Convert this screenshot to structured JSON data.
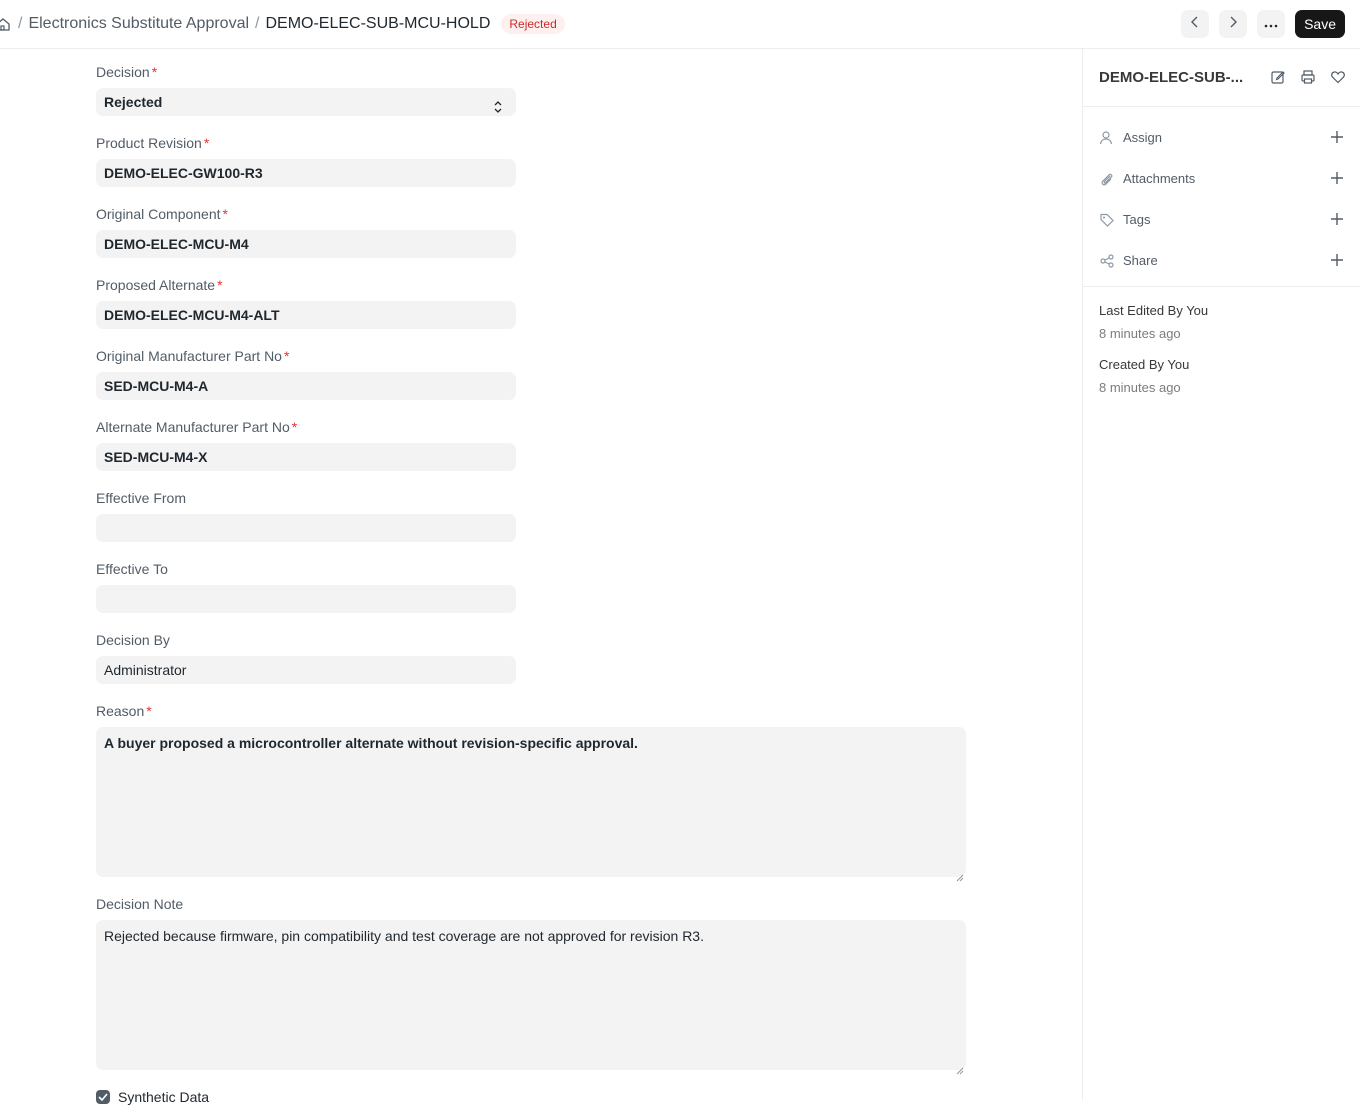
{
  "breadcrumb": {
    "parent": "Electronics Substitute Approval",
    "current": "DEMO-ELEC-SUB-MCU-HOLD",
    "separator": "/"
  },
  "status": {
    "label": "Rejected",
    "color": "#cc2929"
  },
  "toolbar": {
    "save_label": "Save"
  },
  "form": {
    "decision": {
      "label": "Decision",
      "value": "Rejected"
    },
    "product_revision": {
      "label": "Product Revision",
      "value": "DEMO-ELEC-GW100-R3"
    },
    "original_component": {
      "label": "Original Component",
      "value": "DEMO-ELEC-MCU-M4"
    },
    "proposed_alternate": {
      "label": "Proposed Alternate",
      "value": "DEMO-ELEC-MCU-M4-ALT"
    },
    "original_mpn": {
      "label": "Original Manufacturer Part No",
      "value": "SED-MCU-M4-A"
    },
    "alternate_mpn": {
      "label": "Alternate Manufacturer Part No",
      "value": "SED-MCU-M4-X"
    },
    "effective_from": {
      "label": "Effective From",
      "value": ""
    },
    "effective_to": {
      "label": "Effective To",
      "value": ""
    },
    "decision_by": {
      "label": "Decision By",
      "value": "Administrator"
    },
    "reason": {
      "label": "Reason",
      "value": "A buyer proposed a microcontroller alternate without revision-specific approval."
    },
    "decision_note": {
      "label": "Decision Note",
      "value": "Rejected because firmware, pin compatibility and test coverage are not approved for revision R3."
    },
    "synthetic_data": {
      "label": "Synthetic Data",
      "checked": true
    },
    "required_marker": "*"
  },
  "sidebar": {
    "title": "DEMO-ELEC-SUB-...",
    "items": [
      {
        "label": "Assign",
        "icon": "user-icon"
      },
      {
        "label": "Attachments",
        "icon": "paperclip-icon"
      },
      {
        "label": "Tags",
        "icon": "tag-icon"
      },
      {
        "label": "Share",
        "icon": "share-icon"
      }
    ],
    "last_edited": {
      "title": "Last Edited By You",
      "time": "8 minutes ago"
    },
    "created": {
      "title": "Created By You",
      "time": "8 minutes ago"
    }
  }
}
